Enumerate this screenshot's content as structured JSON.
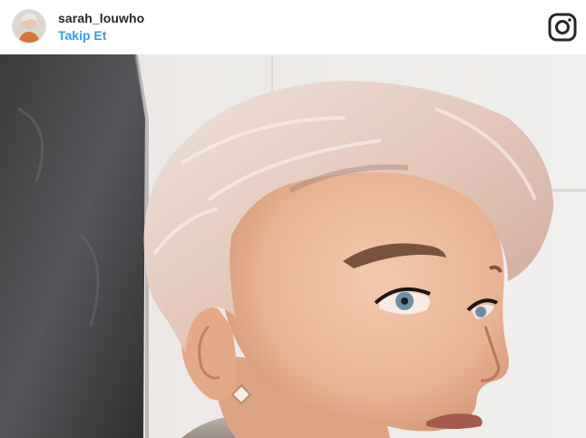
{
  "post": {
    "username": "sarah_louwho",
    "follow_label": "Takip Et"
  },
  "icons": {
    "avatar": "profile-avatar",
    "brand": "instagram-icon"
  },
  "colors": {
    "follow_link": "#3897f0",
    "username_text": "#262626",
    "icon": "#262626"
  }
}
